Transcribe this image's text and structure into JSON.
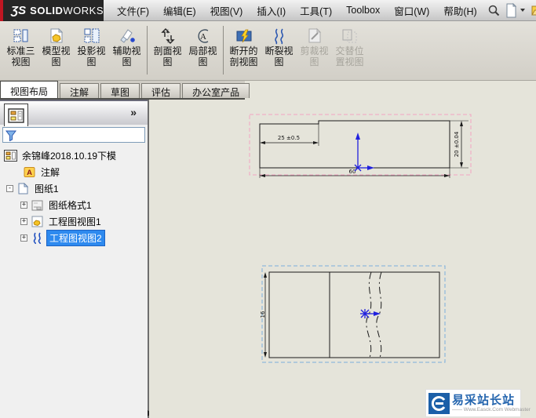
{
  "window": {
    "logo_prefix": "ƷS",
    "logo_bold": "SOLID",
    "logo_light": "WORKS"
  },
  "menubar": {
    "items": [
      "文件(F)",
      "编辑(E)",
      "视图(V)",
      "插入(I)",
      "工具(T)",
      "Toolbox",
      "窗口(W)",
      "帮助(H)"
    ]
  },
  "toolbar": {
    "buttons": [
      {
        "label": "标准三\n视图",
        "enabled": true
      },
      {
        "label": "模型视\n图",
        "enabled": true
      },
      {
        "label": "投影视\n图",
        "enabled": true
      },
      {
        "label": "辅助视\n图",
        "enabled": true
      },
      {
        "label": "剖面视\n图",
        "enabled": true
      },
      {
        "label": "局部视\n图",
        "enabled": true
      },
      {
        "label": "断开的\n剖视图",
        "enabled": true
      },
      {
        "label": "断裂视\n图",
        "enabled": true
      },
      {
        "label": "剪裁视\n图",
        "enabled": false
      },
      {
        "label": "交替位\n置视图",
        "enabled": false
      }
    ]
  },
  "tabs": {
    "items": [
      {
        "label": "视图布局",
        "active": true
      },
      {
        "label": "注解",
        "active": false
      },
      {
        "label": "草图",
        "active": false
      },
      {
        "label": "评估",
        "active": false
      },
      {
        "label": "办公室产品",
        "active": false
      }
    ]
  },
  "panel": {
    "expand_chevron": "»",
    "tree": {
      "items": [
        {
          "label": "余锦峰2018.10.19下模",
          "icon": "feature-tree-icon"
        },
        {
          "label": "注解",
          "icon": "annotations-icon"
        },
        {
          "label": "图纸1",
          "icon": "sheet-icon",
          "expander": "-"
        },
        {
          "label": "图纸格式1",
          "icon": "sheet-format-icon",
          "expander": "+"
        },
        {
          "label": "工程图视图1",
          "icon": "drawing-view-icon",
          "expander": "+"
        },
        {
          "label": "工程图视图2",
          "icon": "break-view-icon",
          "expander": "+",
          "selected": true
        }
      ]
    }
  },
  "drawing": {
    "top_view": {
      "dim_step": "25 ±0.5",
      "dim_width": "60",
      "dim_height": "20 ±0.04"
    },
    "bottom_view": {
      "dim_height": "16"
    }
  },
  "watermark": {
    "title": "易采站长站",
    "subtitle": "—— Www.Easck.Com  Webmaster"
  },
  "colors": {
    "selection_blue": "#2E8AEF",
    "view_border_pink": "#F2A4C2",
    "view_border_blue": "#7AAEDC",
    "drawing_bg": "#E5E4DA",
    "origin_blue": "#2121DE",
    "logo_bg": "#262626",
    "logo_red": "#C01622",
    "watermark_blue": "#1B5FA8"
  }
}
